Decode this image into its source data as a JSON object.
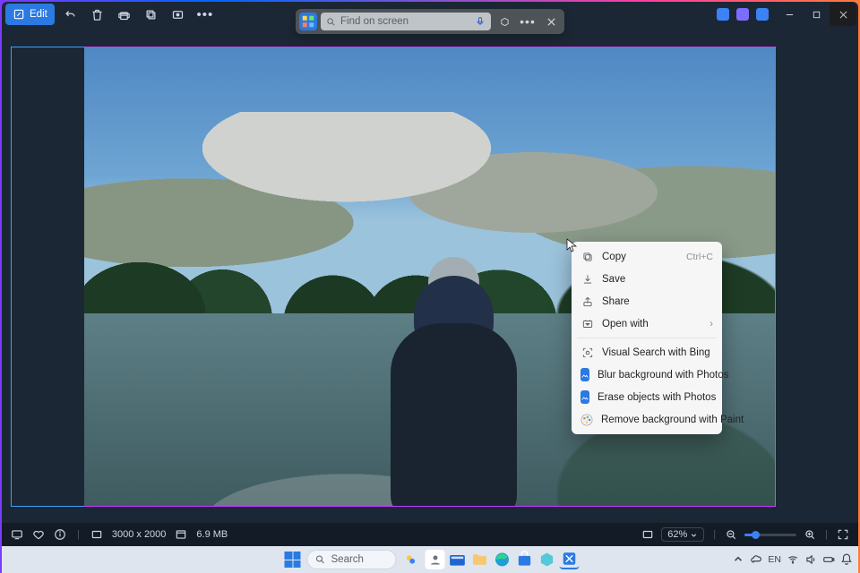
{
  "toolbar": {
    "edit_label": "Edit"
  },
  "search": {
    "placeholder": "Find on screen"
  },
  "context_menu": {
    "items": [
      {
        "label": "Copy",
        "shortcut": "Ctrl+C",
        "icon": "copy"
      },
      {
        "label": "Save",
        "icon": "save"
      },
      {
        "label": "Share",
        "icon": "share"
      },
      {
        "label": "Open with",
        "icon": "openwith",
        "submenu": true
      }
    ],
    "extra_items": [
      {
        "label": "Visual Search with Bing",
        "icon": "visualsearch"
      },
      {
        "label": "Blur background with Photos",
        "icon": "photosapp"
      },
      {
        "label": "Erase objects with Photos",
        "icon": "photosapp"
      },
      {
        "label": "Remove background with Paint",
        "icon": "paintapp"
      }
    ]
  },
  "status": {
    "dimensions": "3000 x 2000",
    "filesize": "6.9 MB",
    "zoom": "62%"
  },
  "taskbar": {
    "search_placeholder": "Search",
    "clock_time": "",
    "clock_date": ""
  }
}
